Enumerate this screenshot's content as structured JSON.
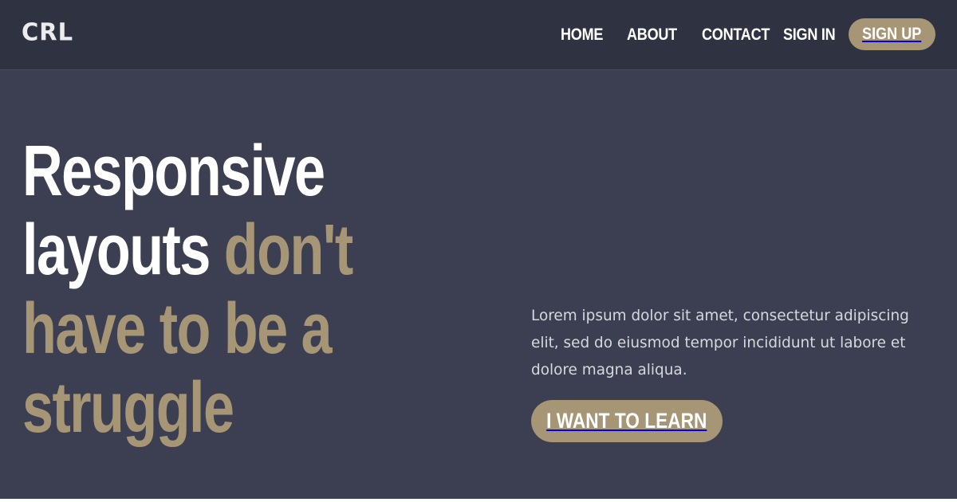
{
  "header": {
    "logo": "CRL",
    "nav": [
      {
        "label": "HOME"
      },
      {
        "label": "ABOUT"
      },
      {
        "label": "CONTACT"
      }
    ],
    "sign_in": "SIGN IN",
    "sign_up": "SIGN UP"
  },
  "hero": {
    "headline_white_1": "Responsive",
    "headline_white_2": "layouts",
    "headline_accent": "don't have to be a struggle",
    "lead": "Lorem ipsum dolor sit amet, consectetur adipiscing elit, sed do eiusmod tempor incididunt ut labore et dolore magna aliqua.",
    "cta": "I WANT TO LEARN"
  },
  "colors": {
    "header_bg": "#2f3241",
    "page_bg": "#3c3f51",
    "accent": "#a69676",
    "text_white": "#ffffff",
    "text_muted": "#d7d8de"
  }
}
